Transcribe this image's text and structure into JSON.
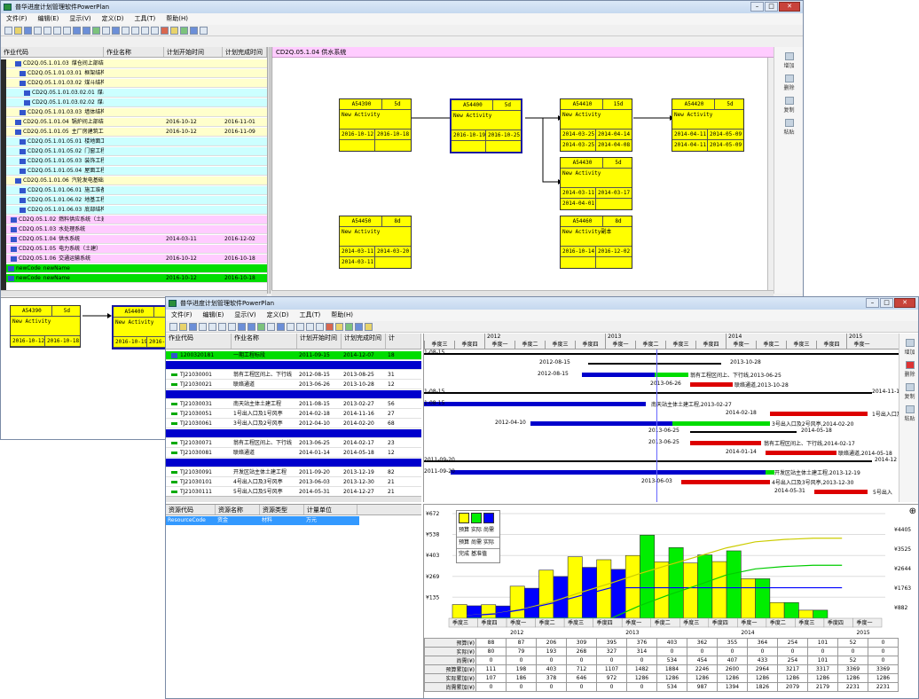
{
  "app": {
    "title": "普华进度计划管理软件PowerPlan",
    "controls": [
      "–",
      "□",
      "✕"
    ]
  },
  "menu": [
    "文件(F)",
    "编辑(E)",
    "显示(V)",
    "定义(D)",
    "工具(T)",
    "帮助(H)"
  ],
  "window1": {
    "columns": [
      "作业代码",
      "作业名称",
      "计划开始时间",
      "计划完成时间"
    ],
    "net_title": "CD2Q.05.1.04 供水系统",
    "side_buttons": [
      "增加",
      "删除",
      "复制",
      "粘贴"
    ],
    "rows": [
      {
        "code": "CD2Q.05.1.01.03",
        "name": "煤仓间上部结构",
        "start": "",
        "finish": "",
        "color": "#ffffcc"
      },
      {
        "code": "CD2Q.05.1.01.03.01",
        "name": "框架结构",
        "start": "",
        "finish": "",
        "color": "#ffffcc"
      },
      {
        "code": "CD2Q.05.1.01.03.02",
        "name": "煤斗结构",
        "start": "",
        "finish": "",
        "color": "#ffffcc"
      },
      {
        "code": "CD2Q.05.1.01.03.02.01",
        "name": "煤斗金属结构安装",
        "start": "",
        "finish": "",
        "color": "#ccffff"
      },
      {
        "code": "CD2Q.05.1.01.03.02.02",
        "name": "煤斗金属结构油漆",
        "start": "",
        "finish": "",
        "color": "#ccffff"
      },
      {
        "code": "CD2Q.05.1.01.03.03",
        "name": "墙体结构",
        "start": "",
        "finish": "",
        "color": "#ffffcc"
      },
      {
        "code": "CD2Q.05.1.01.04",
        "name": "锅炉间上部结构",
        "start": "2016-10-12",
        "finish": "2016-11-01",
        "color": "#ffffcc"
      },
      {
        "code": "CD2Q.05.1.01.05",
        "name": "主厂房建筑工程",
        "start": "2016-10-12",
        "finish": "2016-11-09",
        "color": "#ffffcc"
      },
      {
        "code": "CD2Q.05.1.01.05.01",
        "name": "楼地面工程",
        "start": "",
        "finish": "",
        "color": "#ccffff"
      },
      {
        "code": "CD2Q.05.1.01.05.02",
        "name": "门窗工程",
        "start": "",
        "finish": "",
        "color": "#ccffff"
      },
      {
        "code": "CD2Q.05.1.01.05.03",
        "name": "装饰工程",
        "start": "",
        "finish": "",
        "color": "#ccffff"
      },
      {
        "code": "CD2Q.05.1.01.05.04",
        "name": "屋面工程",
        "start": "",
        "finish": "",
        "color": "#ccffff"
      },
      {
        "code": "CD2Q.05.1.01.06",
        "name": "汽轮发电基础工程",
        "start": "",
        "finish": "",
        "color": "#ffffcc"
      },
      {
        "code": "CD2Q.05.1.01.06.01",
        "name": "施工准备",
        "start": "",
        "finish": "",
        "color": "#ccffff"
      },
      {
        "code": "CD2Q.05.1.01.06.02",
        "name": "地基工程",
        "start": "",
        "finish": "",
        "color": "#ccffff"
      },
      {
        "code": "CD2Q.05.1.01.06.03",
        "name": "底部结构",
        "start": "",
        "finish": "",
        "color": "#ccffff"
      },
      {
        "code": "CD2Q.05.1.02",
        "name": "燃料供应系统（土建）",
        "start": "",
        "finish": "",
        "color": "#ffccff"
      },
      {
        "code": "CD2Q.05.1.03",
        "name": "水处理系统",
        "start": "",
        "finish": "",
        "color": "#ffccff"
      },
      {
        "code": "CD2Q.05.1.04",
        "name": "供水系统",
        "start": "2014-03-11",
        "finish": "2016-12-02",
        "color": "#ffccff"
      },
      {
        "code": "CD2Q.05.1.05",
        "name": "电力系统（土建）",
        "start": "",
        "finish": "",
        "color": "#ffccff"
      },
      {
        "code": "CD2Q.05.1.06",
        "name": "交通运输系统",
        "start": "2016-10-12",
        "finish": "2016-10-18",
        "color": "#ffccff"
      },
      {
        "code": "newCode",
        "name": "newName",
        "start": "",
        "finish": "",
        "color": "#00dd00"
      },
      {
        "code": "newCode",
        "name": "newName",
        "start": "2016-10-12",
        "finish": "2016-10-18",
        "color": "#00dd00"
      }
    ],
    "nodes": [
      {
        "code": "A54390",
        "dur": "5d",
        "name": "New Activity",
        "d1": "2016-10-12",
        "d2": "2016-10-18",
        "d3": "",
        "d4": ""
      },
      {
        "code": "A54400",
        "dur": "5d",
        "name": "New Activity",
        "d1": "2016-10-19",
        "d2": "2016-10-25",
        "d3": "",
        "d4": ""
      },
      {
        "code": "A54410",
        "dur": "15d",
        "name": "New Activity",
        "d1": "2014-03-25",
        "d2": "2014-04-14",
        "d3": "2014-03-25",
        "d4": "2014-04-08"
      },
      {
        "code": "A54420",
        "dur": "5d",
        "name": "New Activity",
        "d1": "2014-04-11",
        "d2": "2014-05-09",
        "d3": "2014-04-11",
        "d4": "2014-05-09"
      },
      {
        "code": "A54430",
        "dur": "5d",
        "name": "New Activity",
        "d1": "2014-03-11",
        "d2": "2014-03-17",
        "d3": "2014-04-01",
        "d4": ""
      },
      {
        "code": "A54450",
        "dur": "8d",
        "name": "New Activity",
        "d1": "2014-03-11",
        "d2": "2014-03-20",
        "d3": "2014-03-11",
        "d4": ""
      },
      {
        "code": "A54460",
        "dur": "8d",
        "name": "New Activity副本",
        "d1": "2016-10-14",
        "d2": "2016-12-02",
        "d3": "",
        "d4": ""
      }
    ],
    "mini_nodes": [
      {
        "code": "A54390",
        "dur": "5d",
        "name": "New Activity",
        "d1": "2016-10-12",
        "d2": "2016-10-18"
      },
      {
        "code": "A54400",
        "dur": "5d",
        "name": "New Activity",
        "d1": "2016-10-19",
        "d2": "2016-10-25"
      }
    ]
  },
  "window2": {
    "columns": [
      "作业代码",
      "作业名称",
      "计划开始时间",
      "计划完成时间",
      "计"
    ],
    "rows": [
      {
        "code": "1200320181",
        "name": "一期工程标段",
        "start": "2011-09-15",
        "finish": "2014-12-07",
        "x": "18",
        "type": "g"
      },
      {
        "code": "",
        "name": "",
        "start": "",
        "finish": "",
        "x": "",
        "type": "b"
      },
      {
        "code": "TJ21030001",
        "name": "翁有工程区间上、下行线",
        "start": "2012-08-15",
        "finish": "2013-08-25",
        "x": "31",
        "type": "w"
      },
      {
        "code": "TJ21030021",
        "name": "联络通道",
        "start": "2013-06-26",
        "finish": "2013-10-28",
        "x": "12",
        "type": "w"
      },
      {
        "code": "",
        "name": "",
        "start": "",
        "finish": "",
        "x": "",
        "type": "b"
      },
      {
        "code": "TJ21030031",
        "name": "南天站主体土建工程",
        "start": "2011-08-15",
        "finish": "2013-02-27",
        "x": "56",
        "type": "w"
      },
      {
        "code": "TJ21030051",
        "name": "1号出入口及1号风亭",
        "start": "2014-02-18",
        "finish": "2014-11-16",
        "x": "27",
        "type": "w"
      },
      {
        "code": "TJ21030061",
        "name": "3号出入口及2号风亭",
        "start": "2012-04-10",
        "finish": "2014-02-20",
        "x": "68",
        "type": "w"
      },
      {
        "code": "",
        "name": "",
        "start": "",
        "finish": "",
        "x": "",
        "type": "b"
      },
      {
        "code": "TJ21030071",
        "name": "翁有工程区间上、下行线",
        "start": "2013-06-25",
        "finish": "2014-02-17",
        "x": "23",
        "type": "w"
      },
      {
        "code": "TJ21030081",
        "name": "联络通道",
        "start": "2014-01-14",
        "finish": "2014-05-18",
        "x": "12",
        "type": "w"
      },
      {
        "code": "",
        "name": "",
        "start": "",
        "finish": "",
        "x": "",
        "type": "b"
      },
      {
        "code": "TJ21030091",
        "name": "开发区站主体土建工程",
        "start": "2011-09-20",
        "finish": "2013-12-19",
        "x": "82",
        "type": "w"
      },
      {
        "code": "TJ21030101",
        "name": "4号出入口及3号风亭",
        "start": "2013-06-03",
        "finish": "2013-12-30",
        "x": "21",
        "type": "w"
      },
      {
        "code": "TJ21030111",
        "name": "5号出入口及5号风亭",
        "start": "2014-05-31",
        "finish": "2014-12-27",
        "x": "21",
        "type": "w"
      }
    ],
    "years": [
      "2012",
      "2013",
      "2014",
      "2015"
    ],
    "quarters": [
      "季度三",
      "季度四",
      "季度一",
      "季度二",
      "季度三",
      "季度四",
      "季度一",
      "季度二",
      "季度三",
      "季度四",
      "季度一",
      "季度二",
      "季度三",
      "季度四",
      "季度一"
    ],
    "gantt_labels": [
      "1-08-15",
      "2012-08-15",
      "2013-10-28",
      "2012-08-15",
      "翁有工程区间上、下行线,2013-06-25",
      "2013-06-26",
      "联络通道,2013-10-28",
      "1-08-15",
      "2014-11-16",
      "1-08-15",
      "南天站主体土建工程,2013-02-27",
      "2014-02-18",
      "1号出入口及",
      "2012-04-10",
      "3号出入口及2号风亭,2014-02-20",
      "2013-06-25",
      "2014-05-18",
      "2013-06-25",
      "翁有工程区间上、下行线,2014-02-17",
      "2014-01-14",
      "联络通道,2014-05-18",
      "2011-09-20",
      "2014-12",
      "2011-09-20",
      "开发区站主体土建工程,2013-12-19",
      "2013-06-03",
      "4号出入口及3号风亭,2013-12-30",
      "2014-05-31",
      "5号出入"
    ],
    "resource": {
      "columns": [
        "资源代码",
        "资源名称",
        "资源类型",
        "计量单位"
      ],
      "row": [
        "ResourceCode",
        "资金",
        "材料",
        "万元"
      ]
    },
    "legend": [
      "预算",
      "实际",
      "尚需",
      "预算",
      "尚需",
      "实际",
      "完成",
      "基准值"
    ],
    "chart_yticks": [
      "¥672",
      "¥538",
      "¥403",
      "¥269",
      "¥135"
    ],
    "chart_rticks": [
      "¥4405",
      "¥3525",
      "¥2644",
      "¥1763",
      "¥882"
    ],
    "chart_quarters": [
      "季度三",
      "季度四",
      "季度一",
      "季度二",
      "季度三",
      "季度四",
      "季度一",
      "季度二",
      "季度三",
      "季度四",
      "季度一",
      "季度二",
      "季度三",
      "季度四",
      "季度一"
    ],
    "chart_years": [
      "2012",
      "2013",
      "2014",
      "2015"
    ],
    "table": [
      {
        "label": "预算(¥)",
        "vals": [
          "88",
          "87",
          "206",
          "309",
          "395",
          "376",
          "403",
          "362",
          "355",
          "364",
          "254",
          "101",
          "52",
          "0"
        ]
      },
      {
        "label": "实际(¥)",
        "vals": [
          "80",
          "79",
          "193",
          "268",
          "327",
          "314",
          "0",
          "0",
          "0",
          "0",
          "0",
          "0",
          "0",
          "0"
        ]
      },
      {
        "label": "尚需(¥)",
        "vals": [
          "0",
          "0",
          "0",
          "0",
          "0",
          "0",
          "534",
          "454",
          "407",
          "433",
          "254",
          "101",
          "52",
          "0"
        ]
      },
      {
        "label": "预算累加(¥)",
        "vals": [
          "111",
          "198",
          "403",
          "712",
          "1107",
          "1482",
          "1884",
          "2246",
          "2600",
          "2964",
          "3217",
          "3317",
          "3369",
          "3369"
        ]
      },
      {
        "label": "实际累加(¥)",
        "vals": [
          "107",
          "186",
          "378",
          "646",
          "972",
          "1286",
          "1286",
          "1286",
          "1286",
          "1286",
          "1286",
          "1286",
          "1286",
          "1286"
        ]
      },
      {
        "label": "尚需累加(¥)",
        "vals": [
          "0",
          "0",
          "0",
          "0",
          "0",
          "0",
          "534",
          "987",
          "1394",
          "1826",
          "2079",
          "2179",
          "2231",
          "2231"
        ]
      }
    ],
    "side_buttons": [
      "增加",
      "删除",
      "复制",
      "粘贴"
    ]
  },
  "chart_data": {
    "type": "bar",
    "categories": [
      "季度三",
      "季度四",
      "季度一",
      "季度二",
      "季度三",
      "季度四",
      "季度一",
      "季度二",
      "季度三",
      "季度四",
      "季度一",
      "季度二",
      "季度三",
      "季度四"
    ],
    "series": [
      {
        "name": "预算",
        "values": [
          88,
          87,
          206,
          309,
          395,
          376,
          403,
          362,
          355,
          364,
          254,
          101,
          52,
          0
        ],
        "color": "#ffff00"
      },
      {
        "name": "实际",
        "values": [
          80,
          79,
          193,
          268,
          327,
          314,
          0,
          0,
          0,
          0,
          0,
          0,
          0,
          0
        ],
        "color": "#0000ff"
      },
      {
        "name": "尚需",
        "values": [
          0,
          0,
          0,
          0,
          0,
          0,
          534,
          454,
          407,
          433,
          254,
          101,
          52,
          0
        ],
        "color": "#00ee00"
      }
    ],
    "ylim": [
      0,
      672
    ]
  }
}
